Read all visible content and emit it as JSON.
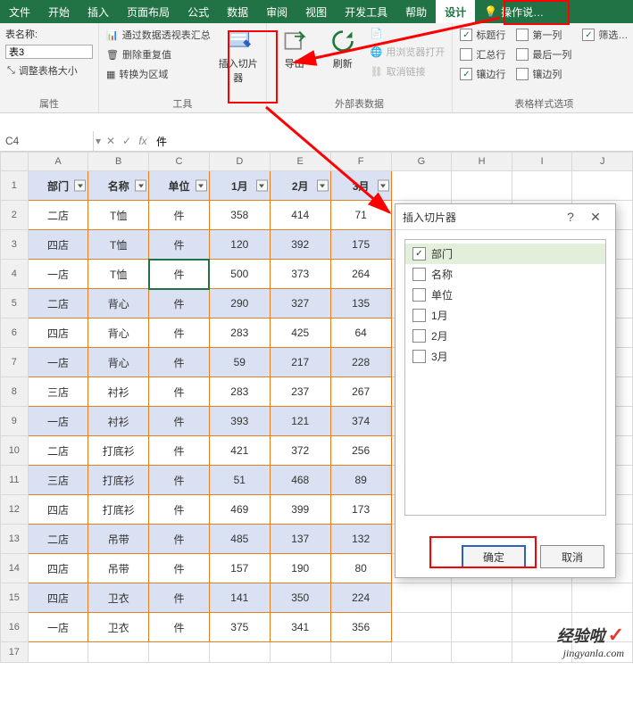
{
  "tabs": [
    "文件",
    "开始",
    "插入",
    "页面布局",
    "公式",
    "数据",
    "审阅",
    "视图",
    "开发工具",
    "帮助",
    "设计"
  ],
  "tell_me": "操作说…",
  "ribbon": {
    "group_props": {
      "label": "属性",
      "table_name_label": "表名称:",
      "table_name_value": "表3",
      "resize_table": "调整表格大小"
    },
    "group_tools": {
      "label": "工具",
      "summarize_pivot": "通过数据透视表汇总",
      "remove_duplicates": "删除重复值",
      "convert_range": "转换为区域",
      "insert_slicer": "插入切片器"
    },
    "group_ext": {
      "label": "外部表数据",
      "export": "导出",
      "refresh": "刷新",
      "open_browser": "用浏览器打开",
      "cancel_link": "取消链接"
    },
    "group_style": {
      "label": "表格样式选项",
      "header_row": "标题行",
      "first_col": "第一列",
      "filter_button": "筛选…",
      "total_row": "汇总行",
      "last_col": "最后一列",
      "banded_rows": "镶边行",
      "banded_cols": "镶边列"
    }
  },
  "namebox": "C4",
  "formula_value": "件",
  "columns": [
    "A",
    "B",
    "C",
    "D",
    "E",
    "F",
    "G",
    "H",
    "I",
    "J"
  ],
  "table": {
    "headers": [
      "部门",
      "名称",
      "单位",
      "1月",
      "2月",
      "3月"
    ],
    "rows": [
      [
        "二店",
        "T恤",
        "件",
        "358",
        "414",
        "71"
      ],
      [
        "四店",
        "T恤",
        "件",
        "120",
        "392",
        "175"
      ],
      [
        "一店",
        "T恤",
        "件",
        "500",
        "373",
        "264"
      ],
      [
        "二店",
        "背心",
        "件",
        "290",
        "327",
        "135"
      ],
      [
        "四店",
        "背心",
        "件",
        "283",
        "425",
        "64"
      ],
      [
        "一店",
        "背心",
        "件",
        "59",
        "217",
        "228"
      ],
      [
        "三店",
        "衬衫",
        "件",
        "283",
        "237",
        "267"
      ],
      [
        "一店",
        "衬衫",
        "件",
        "393",
        "121",
        "374"
      ],
      [
        "二店",
        "打底衫",
        "件",
        "421",
        "372",
        "256"
      ],
      [
        "三店",
        "打底衫",
        "件",
        "51",
        "468",
        "89"
      ],
      [
        "四店",
        "打底衫",
        "件",
        "469",
        "399",
        "173"
      ],
      [
        "二店",
        "吊带",
        "件",
        "485",
        "137",
        "132"
      ],
      [
        "四店",
        "吊带",
        "件",
        "157",
        "190",
        "80"
      ],
      [
        "四店",
        "卫衣",
        "件",
        "141",
        "350",
        "224"
      ],
      [
        "一店",
        "卫衣",
        "件",
        "375",
        "341",
        "356"
      ]
    ]
  },
  "dialog": {
    "title": "插入切片器",
    "options": [
      "部门",
      "名称",
      "单位",
      "1月",
      "2月",
      "3月"
    ],
    "ok": "确定",
    "cancel": "取消"
  },
  "watermark": {
    "line1": "经验啦",
    "line2": "jingyanla.com"
  },
  "chart_data": {
    "type": "table",
    "headers": [
      "部门",
      "名称",
      "单位",
      "1月",
      "2月",
      "3月"
    ],
    "rows": [
      [
        "二店",
        "T恤",
        "件",
        358,
        414,
        71
      ],
      [
        "四店",
        "T恤",
        "件",
        120,
        392,
        175
      ],
      [
        "一店",
        "T恤",
        "件",
        500,
        373,
        264
      ],
      [
        "二店",
        "背心",
        "件",
        290,
        327,
        135
      ],
      [
        "四店",
        "背心",
        "件",
        283,
        425,
        64
      ],
      [
        "一店",
        "背心",
        "件",
        59,
        217,
        228
      ],
      [
        "三店",
        "衬衫",
        "件",
        283,
        237,
        267
      ],
      [
        "一店",
        "衬衫",
        "件",
        393,
        121,
        374
      ],
      [
        "二店",
        "打底衫",
        "件",
        421,
        372,
        256
      ],
      [
        "三店",
        "打底衫",
        "件",
        51,
        468,
        89
      ],
      [
        "四店",
        "打底衫",
        "件",
        469,
        399,
        173
      ],
      [
        "二店",
        "吊带",
        "件",
        485,
        137,
        132
      ],
      [
        "四店",
        "吊带",
        "件",
        157,
        190,
        80
      ],
      [
        "四店",
        "卫衣",
        "件",
        141,
        350,
        224
      ],
      [
        "一店",
        "卫衣",
        "件",
        375,
        341,
        356
      ]
    ]
  }
}
